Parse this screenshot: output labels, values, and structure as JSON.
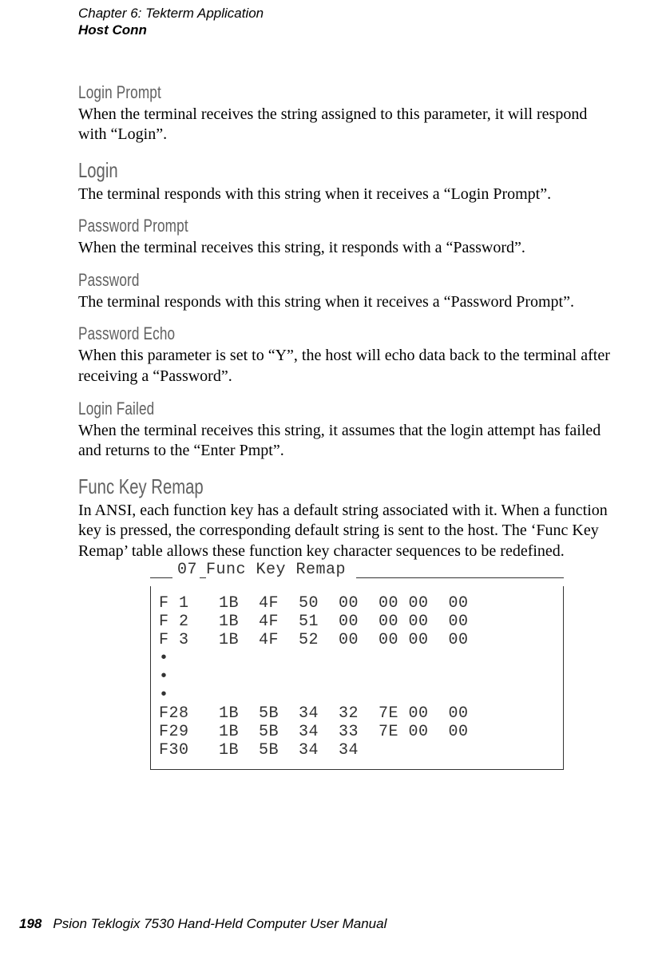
{
  "header": {
    "chapter": "Chapter  6:  Tekterm Application",
    "section": "Host Conn"
  },
  "content": {
    "s1": {
      "title": "Login Prompt",
      "body": "When the terminal receives the string assigned to this parameter, it will respond with “Login”."
    },
    "s2": {
      "title": "Login",
      "body": "The terminal responds with this string when it receives a “Login Prompt”."
    },
    "s3": {
      "title": "Password Prompt",
      "body": "When the terminal receives this string, it responds with a “Password”."
    },
    "s4": {
      "title": "Password",
      "body": "The terminal responds with this string when it receives a “Password Prompt”."
    },
    "s5": {
      "title": "Password Echo",
      "body": "When this parameter is set to “Y”, the host will echo data back to the terminal after receiving a “Password”."
    },
    "s6": {
      "title": "Login Failed",
      "body": "When the terminal receives this string, it assumes that the login attempt has failed and returns to the “Enter Pmpt”."
    },
    "s7": {
      "title": "Func Key Remap",
      "body": "In ANSI, each function key has a default string associated with it. When a function key is pressed, the corresponding default string is sent to the host. The ‘Func Key Remap’ table allows these function key character sequences to be redefined."
    }
  },
  "codebox": {
    "num": "07",
    "title": "Func Key Remap",
    "rows": [
      "F 1   1B  4F  50  00  00 00  00",
      "F 2   1B  4F  51  00  00 00  00",
      "F 3   1B  4F  52  00  00 00  00",
      "•",
      "•",
      "•",
      "F28   1B  5B  34  32  7E 00  00",
      "F29   1B  5B  34  33  7E 00  00",
      "F30   1B  5B  34  34"
    ]
  },
  "footer": {
    "page": "198",
    "text": "Psion Teklogix 7530 Hand-Held Computer User Manual"
  }
}
